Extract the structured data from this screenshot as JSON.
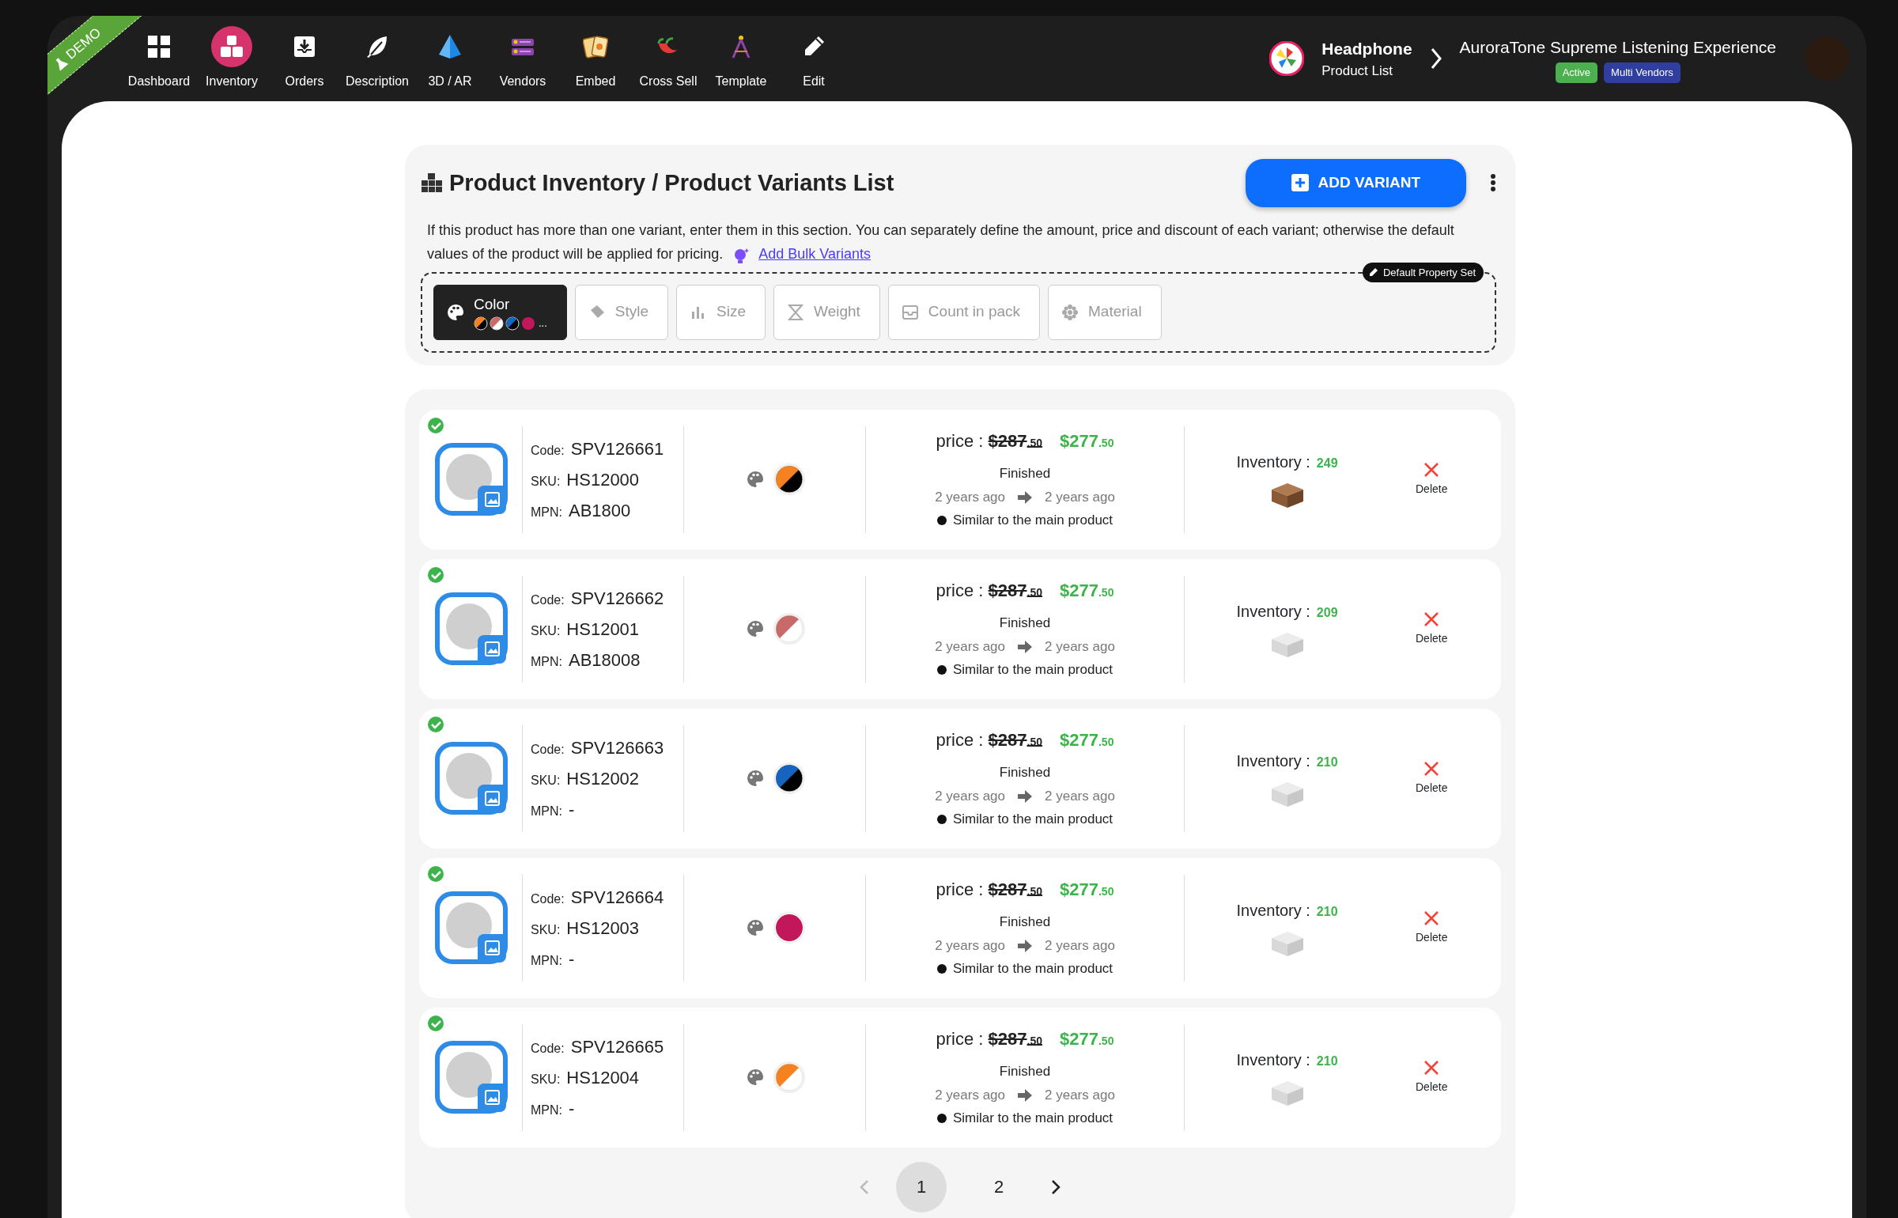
{
  "ribbon": {
    "label": "DEMO"
  },
  "nav": [
    {
      "label": "Dashboard",
      "selected": false
    },
    {
      "label": "Inventory",
      "selected": true
    },
    {
      "label": "Orders",
      "selected": false
    },
    {
      "label": "Description",
      "selected": false
    },
    {
      "label": "3D / AR",
      "selected": false
    },
    {
      "label": "Vendors",
      "selected": false
    },
    {
      "label": "Embed",
      "selected": false
    },
    {
      "label": "Cross Sell",
      "selected": false
    },
    {
      "label": "Template",
      "selected": false
    },
    {
      "label": "Edit",
      "selected": false
    }
  ],
  "breadcrumb": {
    "category": "Headphone",
    "subtitle": "Product List",
    "product": "AuroraTone Supreme Listening Experience",
    "badges": [
      {
        "label": "Active",
        "color": "#4caf50"
      },
      {
        "label": "Multi Vendors",
        "color": "#303f9f"
      }
    ]
  },
  "header": {
    "title": "Product Inventory / Product Variants List",
    "add_button": "ADD VARIANT",
    "description": "If this product has more than one variant, enter them in this section. You can separately define the amount, price and discount of each variant; otherwise the default values of the product will be applied for pricing.",
    "bulk_link": "Add Bulk Variants",
    "default_set": "Default Property Set"
  },
  "properties": [
    {
      "label": "Color",
      "selected": true,
      "swatches": [
        {
          "color": "#f58220",
          "kind": "dark"
        },
        {
          "color": "#c96a6a",
          "kind": "light"
        },
        {
          "color": "#1565c0",
          "kind": "dark"
        },
        {
          "color": "#c2185b",
          "kind": "solid"
        }
      ],
      "more": "..."
    },
    {
      "label": "Style",
      "selected": false
    },
    {
      "label": "Size",
      "selected": false
    },
    {
      "label": "Weight",
      "selected": false
    },
    {
      "label": "Count in pack",
      "selected": false
    },
    {
      "label": "Material",
      "selected": false
    }
  ],
  "variants": [
    {
      "verified": true,
      "code_label": "Code:",
      "code": "SPV126661",
      "sku_label": "SKU:",
      "sku": "HS12000",
      "mpn_label": "MPN:",
      "mpn": "AB1800",
      "swatch": {
        "color": "#f58220",
        "kind": "dark"
      },
      "price_label": "price :",
      "old_price": "$287",
      "old_cents": ".50",
      "new_price": "$277",
      "new_cents": ".50",
      "status": "Finished",
      "from": "2 years ago",
      "to": "2 years ago",
      "note": "Similar to the main product",
      "inventory_label": "Inventory :",
      "inventory": "249",
      "box_filled": true,
      "delete": "Delete"
    },
    {
      "verified": true,
      "code_label": "Code:",
      "code": "SPV126662",
      "sku_label": "SKU:",
      "sku": "HS12001",
      "mpn_label": "MPN:",
      "mpn": "AB18008",
      "swatch": {
        "color": "#c96a6a",
        "kind": "light"
      },
      "price_label": "price :",
      "old_price": "$287",
      "old_cents": ".50",
      "new_price": "$277",
      "new_cents": ".50",
      "status": "Finished",
      "from": "2 years ago",
      "to": "2 years ago",
      "note": "Similar to the main product",
      "inventory_label": "Inventory :",
      "inventory": "209",
      "box_filled": false,
      "delete": "Delete"
    },
    {
      "verified": true,
      "code_label": "Code:",
      "code": "SPV126663",
      "sku_label": "SKU:",
      "sku": "HS12002",
      "mpn_label": "MPN:",
      "mpn": "-",
      "swatch": {
        "color": "#1565c0",
        "kind": "dark"
      },
      "price_label": "price :",
      "old_price": "$287",
      "old_cents": ".50",
      "new_price": "$277",
      "new_cents": ".50",
      "status": "Finished",
      "from": "2 years ago",
      "to": "2 years ago",
      "note": "Similar to the main product",
      "inventory_label": "Inventory :",
      "inventory": "210",
      "box_filled": false,
      "delete": "Delete"
    },
    {
      "verified": true,
      "code_label": "Code:",
      "code": "SPV126664",
      "sku_label": "SKU:",
      "sku": "HS12003",
      "mpn_label": "MPN:",
      "mpn": "-",
      "swatch": {
        "color": "#c2185b",
        "kind": "solid"
      },
      "price_label": "price :",
      "old_price": "$287",
      "old_cents": ".50",
      "new_price": "$277",
      "new_cents": ".50",
      "status": "Finished",
      "from": "2 years ago",
      "to": "2 years ago",
      "note": "Similar to the main product",
      "inventory_label": "Inventory :",
      "inventory": "210",
      "box_filled": false,
      "delete": "Delete"
    },
    {
      "verified": true,
      "code_label": "Code:",
      "code": "SPV126665",
      "sku_label": "SKU:",
      "sku": "HS12004",
      "mpn_label": "MPN:",
      "mpn": "-",
      "swatch": {
        "color": "#f58220",
        "kind": "light"
      },
      "price_label": "price :",
      "old_price": "$287",
      "old_cents": ".50",
      "new_price": "$277",
      "new_cents": ".50",
      "status": "Finished",
      "from": "2 years ago",
      "to": "2 years ago",
      "note": "Similar to the main product",
      "inventory_label": "Inventory :",
      "inventory": "210",
      "box_filled": false,
      "delete": "Delete"
    }
  ],
  "pagination": {
    "prev_disabled": true,
    "pages": [
      {
        "label": "1",
        "selected": true
      },
      {
        "label": "2",
        "selected": false
      }
    ]
  }
}
